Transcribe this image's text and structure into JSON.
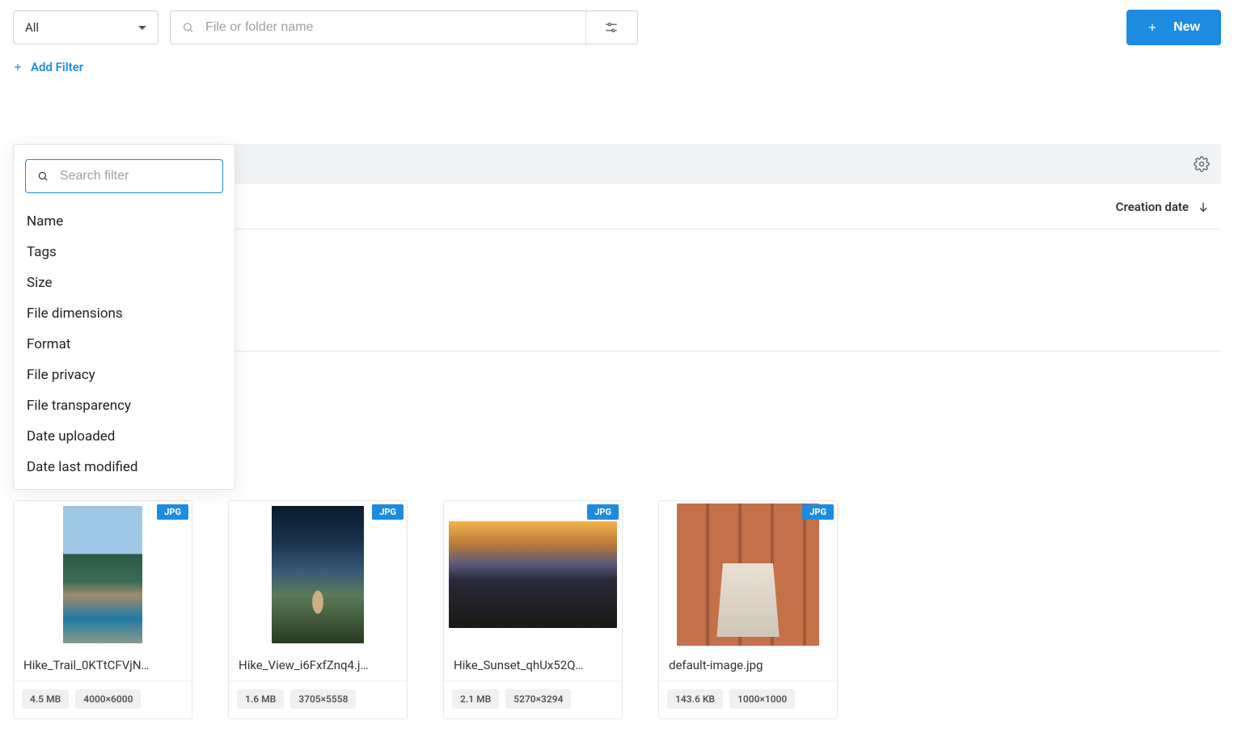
{
  "toolbar": {
    "type_filter": "All",
    "search_placeholder": "File or folder name",
    "new_label": "New"
  },
  "filters": {
    "add_filter_label": "Add Filter",
    "search_placeholder": "Search filter",
    "options": [
      "Name",
      "Tags",
      "Size",
      "File dimensions",
      "Format",
      "File privacy",
      "File transparency",
      "Date uploaded",
      "Date last modified"
    ]
  },
  "sort": {
    "label": "Creation date",
    "direction": "desc"
  },
  "files": [
    {
      "name": "Hike_Trail_0KTtCFVjN…",
      "format": "JPG",
      "size": "4.5 MB",
      "dimensions": "4000×6000",
      "thumb": "thumb-trail"
    },
    {
      "name": "Hike_View_i6FxfZnq4.j…",
      "format": "JPG",
      "size": "1.6 MB",
      "dimensions": "3705×5558",
      "thumb": "thumb-view"
    },
    {
      "name": "Hike_Sunset_qhUx52Q…",
      "format": "JPG",
      "size": "2.1 MB",
      "dimensions": "5270×3294",
      "thumb": "thumb-sunset"
    },
    {
      "name": "default-image.jpg",
      "format": "JPG",
      "size": "143.6 KB",
      "dimensions": "1000×1000",
      "thumb": "thumb-default"
    }
  ]
}
